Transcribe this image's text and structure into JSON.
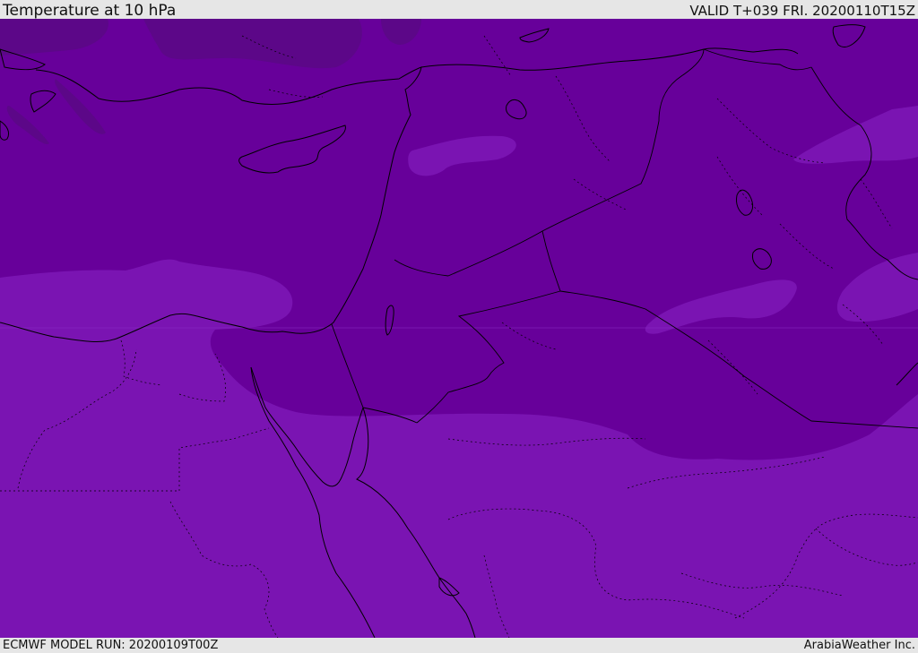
{
  "header": {
    "title": "Temperature at 10 hPa",
    "valid": "VALID T+039 FRI. 20200110T15Z"
  },
  "footer": {
    "model_run": "ECMWF MODEL RUN: 20200109T00Z",
    "credit": "ArabiaWeather Inc."
  },
  "colors": {
    "band_cold": "#5c0788",
    "band_mid": "#67009a",
    "band_warm": "#7a14b2",
    "band_warmer": "#8a2cc4",
    "lines": "#000000",
    "bar_background": "#e6e6e6"
  }
}
